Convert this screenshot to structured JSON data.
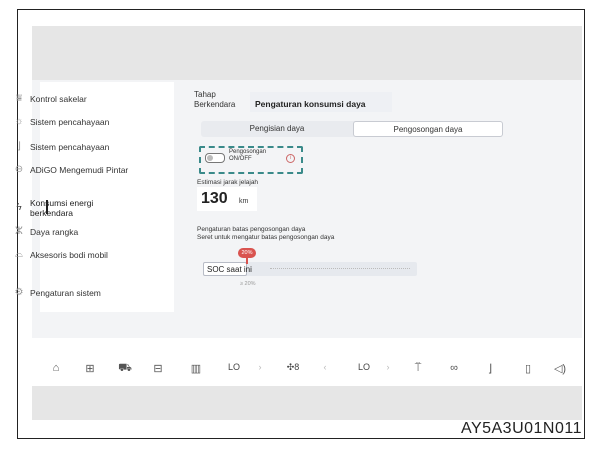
{
  "sidebar": {
    "items": [
      {
        "label": "Kontrol sakelar",
        "icon": "switch-lines-icon"
      },
      {
        "label": "Sistem pencahayaan",
        "icon": "sun-icon"
      },
      {
        "label": "Sistem pencahayaan",
        "icon": "seat-icon"
      },
      {
        "label": "ADiGO Mengemudi Pintar",
        "icon": "steering-wheel-icon"
      },
      {
        "label": "Konsumsi energi berkendara",
        "icon": "lightning-icon",
        "active": true
      },
      {
        "label": "Daya rangka",
        "icon": "chassis-icon"
      },
      {
        "label": "Aksesoris bodi mobil",
        "icon": "car-icon"
      },
      {
        "label": "Pengaturan sistem",
        "icon": "gear-icon"
      }
    ]
  },
  "header": {
    "tahap": "Tahap Berkendara",
    "title": "Pengaturan konsumsi daya"
  },
  "tabs": [
    {
      "label": "Pengisian daya",
      "selected": false
    },
    {
      "label": "Pengosongan daya",
      "selected": true
    }
  ],
  "toggle": {
    "label": "Pengosongan ON/OFF",
    "info": "i",
    "on": false
  },
  "estimate": {
    "label": "Estimasi jarak jelajah",
    "value": "130",
    "unit": "km"
  },
  "limit": {
    "line1": "Pengaturan batas pengosongan daya",
    "line2": "Seret untuk mengatur batas pengosongan daya",
    "slider_label": "SOC saat ini",
    "bubble": "20%",
    "below": "≥ 20%",
    "level_percent": 20
  },
  "dock": {
    "items": [
      {
        "icon": "home-icon"
      },
      {
        "icon": "apps-grid-icon"
      },
      {
        "icon": "car-icon"
      },
      {
        "icon": "lock-icon"
      },
      {
        "icon": "rear-defrost-icon"
      },
      {
        "text": "LO"
      },
      {
        "icon": "chevron-right-icon"
      },
      {
        "icon": "fan-icon",
        "text": "8"
      },
      {
        "text": "LO"
      },
      {
        "icon": "chevron-right-icon"
      },
      {
        "icon": "windshield-defrost-icon"
      },
      {
        "icon": "air-recirculation-icon"
      },
      {
        "icon": "seat-heat-icon"
      },
      {
        "icon": "phone-icon"
      },
      {
        "icon": "volume-icon"
      }
    ],
    "lo_left": "LO",
    "lo_right": "LO",
    "fan_speed": "8"
  },
  "doc_id": "AY5A3U01N011",
  "colors": {
    "accent_dashed": "#3a8a8a",
    "bubble": "#d9534f"
  }
}
